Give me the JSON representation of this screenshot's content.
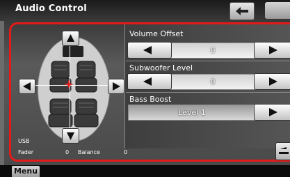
{
  "header": {
    "title": "Audio Control"
  },
  "controls": {
    "volume_offset": {
      "label": "Volume Offset",
      "value": "0"
    },
    "subwoofer_level": {
      "label": "Subwoofer Level",
      "value": "0"
    },
    "bass_boost": {
      "label": "Bass Boost",
      "value": "Level 1"
    }
  },
  "status": {
    "source": "USB",
    "fader_label": "Fader",
    "fader_value": "0",
    "balance_label": "Balance",
    "balance_value": "0"
  },
  "footer": {
    "menu_label": "Menu"
  },
  "colors": {
    "accent_frame": "#e21a1a",
    "position_marker": "#e02020"
  },
  "icons": [
    "left-arrow-icon",
    "right-arrow-icon",
    "up-arrow-icon",
    "down-arrow-icon",
    "back-arrow-icon",
    "collapse-icon",
    "cabin-seats-icon",
    "position-marker-icon"
  ]
}
